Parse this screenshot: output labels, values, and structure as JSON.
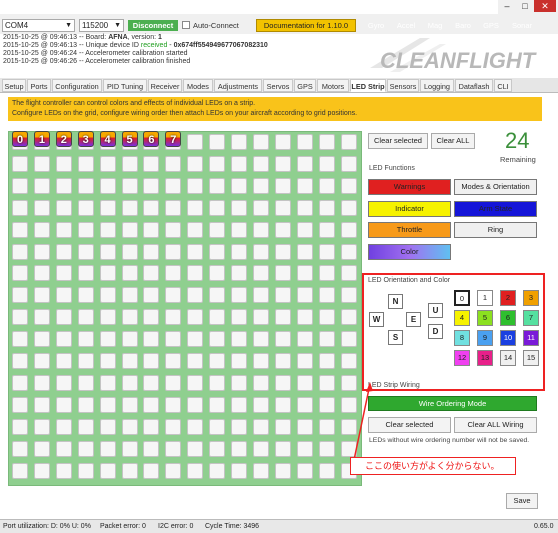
{
  "topbar": {
    "port": "COM4",
    "baud": "115200",
    "disconnect": "Disconnect",
    "auto_connect": "Auto-Connect",
    "documentation": "Documentation for 1.10.0",
    "sensors": [
      "Gyro",
      "Accel",
      "Mag",
      "Baro",
      "GPS",
      "Sonar"
    ],
    "sensor_colors": [
      "#f2c200",
      "#f2c200",
      "#f2c200",
      "#f2c200",
      "#e02020",
      "#e02020"
    ]
  },
  "log": [
    {
      "time": "2015-10-25 @ 09:46:13",
      "text": " -- Board: ",
      "bold": "AFNA",
      "rest": ", version: ",
      "ver": "1"
    },
    {
      "time": "2015-10-25 @ 09:46:13",
      "text": " -- Unique device ID ",
      "ok": "received",
      "rest2": " - ",
      "bold": "0x674ff554949677067082310"
    },
    {
      "time": "2015-10-25 @ 09:46:24",
      "text": " -- Accelerometer calibration started"
    },
    {
      "time": "2015-10-25 @ 09:46:26",
      "text": " -- Accelerometer calibration finished"
    }
  ],
  "logo": "CLEANFLIGHT",
  "tabs": [
    "Setup",
    "Ports",
    "Configuration",
    "PID Tuning",
    "Receiver",
    "Modes",
    "Adjustments",
    "Servos",
    "GPS",
    "Motors",
    "LED Strip",
    "Sensors",
    "Logging",
    "Dataflash",
    "CLI"
  ],
  "active_tab": "LED Strip",
  "info": {
    "line1": "The flight controller can control colors and effects of individual LEDs on a strip.",
    "line2": "Configure LEDs on the grid, configure wiring order then attach LEDs on your aircraft according to grid positions."
  },
  "wired_leds": [
    "0",
    "1",
    "2",
    "3",
    "4",
    "5",
    "6",
    "7"
  ],
  "remaining": {
    "count": "24",
    "label": "Remaining"
  },
  "buttons": {
    "clear_selected": "Clear selected",
    "clear_all": "Clear ALL",
    "wire_ordering": "Wire Ordering Mode",
    "clear_selected_wiring": "Clear selected",
    "clear_all_wiring": "Clear ALL Wiring",
    "save": "Save"
  },
  "led_functions": {
    "title": "LED Functions",
    "items": [
      {
        "label": "Warnings",
        "color": "#e02020"
      },
      {
        "label": "Modes & Orientation",
        "color": "#f0f0f0"
      },
      {
        "label": "Indicator",
        "color": "#f6f200"
      },
      {
        "label": "Arm State",
        "color": "#1515d8"
      },
      {
        "label": "Throttle",
        "color": "#f79a1a"
      },
      {
        "label": "Ring",
        "color": "#f0f0f0"
      },
      {
        "label": "Color",
        "color": "#8a5cf0"
      }
    ]
  },
  "orientation": {
    "title": "LED Orientation and Color",
    "directions": [
      "N",
      "W",
      "E",
      "S",
      "U",
      "D"
    ],
    "colors": [
      {
        "n": "0",
        "c": "#ffffff"
      },
      {
        "n": "1",
        "c": "#ffffff"
      },
      {
        "n": "2",
        "c": "#e02020"
      },
      {
        "n": "3",
        "c": "#f0a000"
      },
      {
        "n": "4",
        "c": "#f6f200"
      },
      {
        "n": "5",
        "c": "#8be020"
      },
      {
        "n": "6",
        "c": "#2fbf2f"
      },
      {
        "n": "7",
        "c": "#55e0a0"
      },
      {
        "n": "8",
        "c": "#70e0e0"
      },
      {
        "n": "9",
        "c": "#4aa0f0"
      },
      {
        "n": "10",
        "c": "#1a3fe0"
      },
      {
        "n": "11",
        "c": "#7a1ad8"
      },
      {
        "n": "12",
        "c": "#f040f0"
      },
      {
        "n": "13",
        "c": "#e8208a"
      },
      {
        "n": "14",
        "c": "#f0f0f0"
      },
      {
        "n": "15",
        "c": "#f0f0f0"
      }
    ]
  },
  "wiring": {
    "title": "LED Strip Wiring",
    "note": "LEDs without wire ordering number will not be saved."
  },
  "callout": "ここの使い方がよく分からない。",
  "status": {
    "port_util": "Port utilization: D: 0% U: 0%",
    "packet_error": "Packet error: 0",
    "i2c_error": "I2C error: 0",
    "cycle_time": "Cycle Time: 3496",
    "version": "0.65.0"
  }
}
